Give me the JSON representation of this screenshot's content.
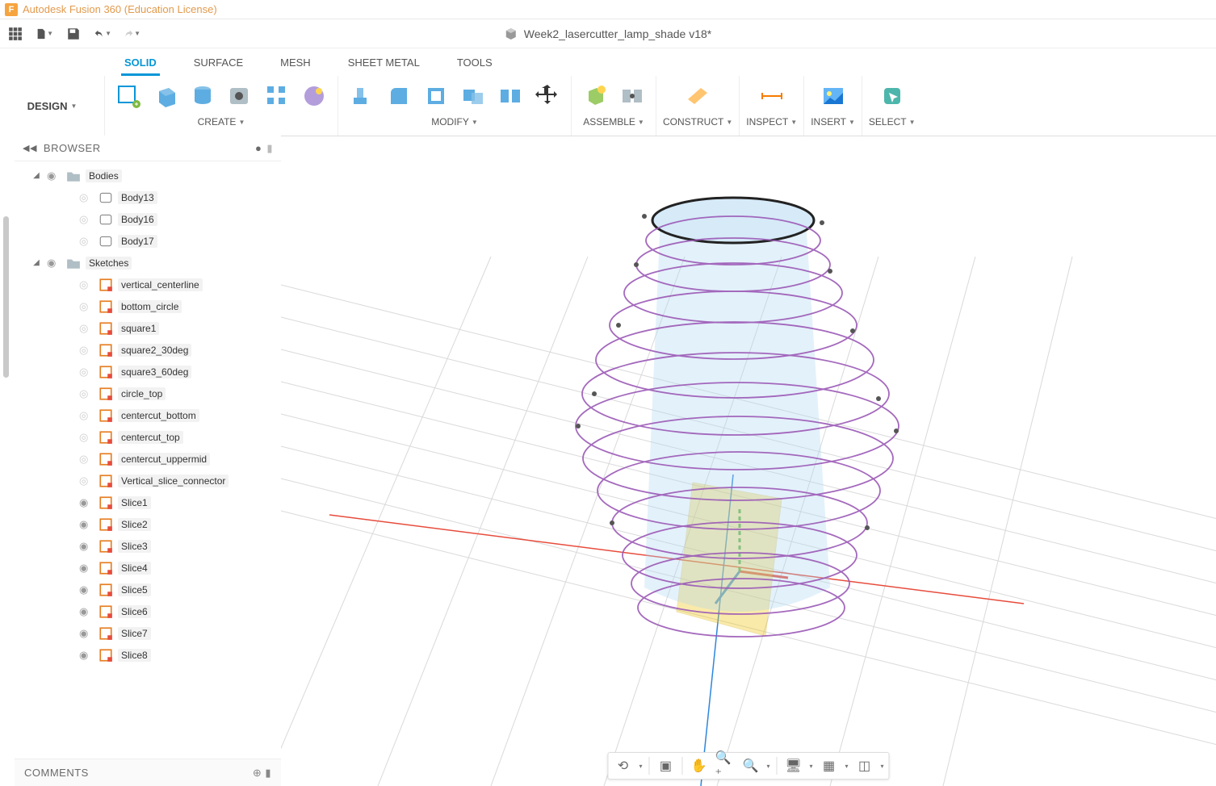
{
  "app": {
    "title": "Autodesk Fusion 360 (Education License)",
    "icon_letter": "F",
    "document": "Week2_lasercutter_lamp_shade v18*",
    "workspace": "DESIGN"
  },
  "ribbon_tabs": [
    "SOLID",
    "SURFACE",
    "MESH",
    "SHEET METAL",
    "TOOLS"
  ],
  "ribbon_groups": {
    "create": "CREATE",
    "modify": "MODIFY",
    "assemble": "ASSEMBLE",
    "construct": "CONSTRUCT",
    "inspect": "INSPECT",
    "insert": "INSERT",
    "select": "SELECT"
  },
  "browser": {
    "title": "BROWSER",
    "comments": "COMMENTS",
    "folders": {
      "bodies": "Bodies",
      "sketches": "Sketches"
    },
    "bodies": [
      "Body13",
      "Body16",
      "Body17"
    ],
    "sketches": [
      {
        "name": "vertical_centerline",
        "visible": false
      },
      {
        "name": "bottom_circle",
        "visible": false
      },
      {
        "name": "square1",
        "visible": false
      },
      {
        "name": "square2_30deg",
        "visible": false
      },
      {
        "name": "square3_60deg",
        "visible": false
      },
      {
        "name": "circle_top",
        "visible": false
      },
      {
        "name": "centercut_bottom",
        "visible": false
      },
      {
        "name": "centercut_top",
        "visible": false
      },
      {
        "name": "centercut_uppermid",
        "visible": false
      },
      {
        "name": "Vertical_slice_connector",
        "visible": false
      },
      {
        "name": "Slice1",
        "visible": true
      },
      {
        "name": "Slice2",
        "visible": true
      },
      {
        "name": "Slice3",
        "visible": true
      },
      {
        "name": "Slice4",
        "visible": true
      },
      {
        "name": "Slice5",
        "visible": true
      },
      {
        "name": "Slice6",
        "visible": true
      },
      {
        "name": "Slice7",
        "visible": true
      },
      {
        "name": "Slice8",
        "visible": true
      }
    ]
  }
}
